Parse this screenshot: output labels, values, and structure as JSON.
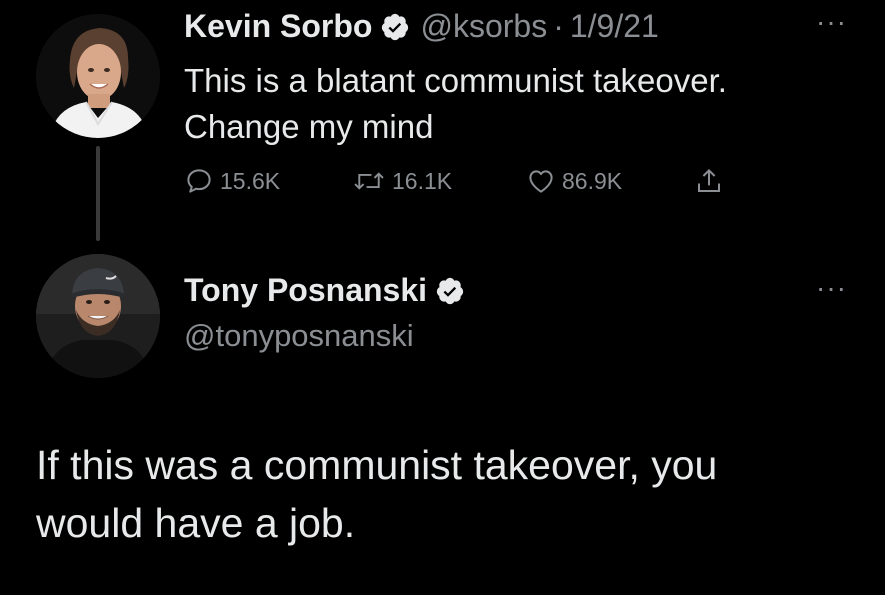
{
  "tweet": {
    "author_name": "Kevin Sorbo",
    "handle": "@ksorbs",
    "separator": "·",
    "date": "1/9/21",
    "more_label": "···",
    "text_line1": "This is a blatant communist takeover.",
    "text_line2": "Change my mind",
    "stats": {
      "replies": "15.6K",
      "retweets": "16.1K",
      "likes": "86.9K"
    }
  },
  "reply": {
    "author_name": "Tony Posnanski",
    "handle": "@tonyposnanski",
    "more_label": "···",
    "text_line1": "If this was a communist takeover, you",
    "text_line2": "would have a job."
  },
  "colors": {
    "background": "#000000",
    "text": "#e7e9ea",
    "secondary": "#8b8f94",
    "thread_line": "#3a3a3a"
  }
}
